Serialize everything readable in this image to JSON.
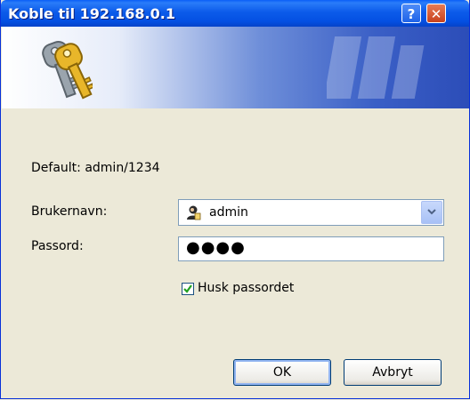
{
  "window": {
    "title": "Koble til 192.168.0.1",
    "help_glyph": "?",
    "close_glyph": "✕"
  },
  "banner": {
    "icon": "keys-icon"
  },
  "form": {
    "default_text": "Default: admin/1234",
    "username_label": "Brukernavn:",
    "username_value": "admin",
    "password_label": "Passord:",
    "password_mask": "●●●●",
    "remember_label": "Husk passordet",
    "remember_checked": true
  },
  "buttons": {
    "ok": "OK",
    "cancel": "Avbryt"
  },
  "colors": {
    "titlebar": "#0450e2",
    "dialog_bg": "#ece9d8",
    "close_button": "#c8421d"
  }
}
